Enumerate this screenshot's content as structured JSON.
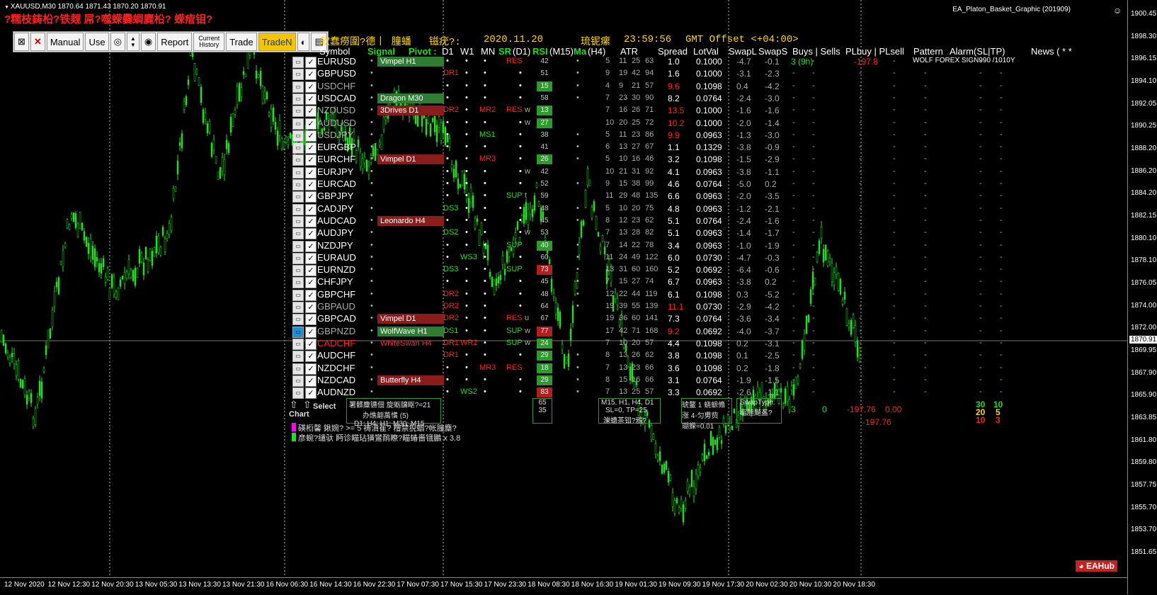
{
  "chart": {
    "symbol_header": "XAUUSD,M30  1870.64 1871.43 1870.20 1870.91",
    "title_red": "?糯枝鋳柗?铁觌  屌?噬蝾爨蜩麑柗? 蝾痯钼?",
    "ea_label": "EA_Platon_Basket_Graphic (201909)",
    "current_price": "1870.91",
    "price_ticks": [
      "1900.45",
      "1898.30",
      "1896.15",
      "1894.10",
      "1892.05",
      "1890.25",
      "1888.20",
      "1886.20",
      "1884.20",
      "1882.15",
      "1880.10",
      "1878.10",
      "1876.05",
      "1874.00",
      "1872.00",
      "1869.95",
      "1867.90",
      "1865.90",
      "1863.85",
      "1861.80",
      "1859.80",
      "1857.75",
      "1855.70",
      "1853.70",
      "1851.65"
    ],
    "time_ticks": [
      "12 Nov 2020",
      "12 Nov 12:30",
      "12 Nov 20:30",
      "13 Nov 05:30",
      "13 Nov 13:30",
      "13 Nov 21:30",
      "16 Nov 06:30",
      "16 Nov 14:30",
      "16 Nov 22:30",
      "17 Nov 07:30",
      "17 Nov 15:30",
      "17 Nov 23:30",
      "18 Nov 08:30",
      "18 Nov 16:30",
      "19 Nov 01:30",
      "19 Nov 09:30",
      "19 Nov 17:30",
      "20 Nov 02:30",
      "20 Nov 10:30",
      "20 Nov 18:30"
    ],
    "watermark": "EAHub",
    "colors": {
      "bull": "#22dd22",
      "bear": "#22dd22",
      "bg": "#000000"
    }
  },
  "toolbar": {
    "buttons": [
      "Manual",
      "Use",
      "Report",
      "Current History",
      "Trade",
      "TradeN"
    ],
    "active": "TradeN"
  },
  "dashboard": {
    "left_label": "软蠢痨圍?德丨 膧蟠",
    "date_label": "镃疣?:",
    "date_value": "2020.11.20",
    "time_label": "琉铌瘰",
    "time_value": "23:59:56",
    "gmt": "GMT Offset <+04:00>",
    "headers": [
      "Symbol",
      "Signal",
      "Pivot :",
      "D1",
      "W1",
      "MN",
      "SR",
      "(D1)",
      "RSI",
      "(M15)",
      "Ma",
      "(H4)",
      "ATR",
      "Spread",
      "LotVal",
      "SwapL",
      "SwapS",
      "Buys | Sells",
      "PLbuy | PLsell",
      "Pattern",
      "Alarm(SL|TP)",
      "News ( * *"
    ],
    "rows": [
      {
        "sym": "EURUSD",
        "sc": "wht",
        "sig": "Vimpel H1",
        "sigc": "green",
        "d1": "•",
        "w1": "•",
        "mn": "•",
        "sr": "RES",
        "rsi": "42",
        "rsic": "",
        "ma": "•",
        "atr": [
          "5",
          "11",
          "25",
          "63"
        ],
        "spread": "1.0",
        "sprc": "wht",
        "lot": "0.1000",
        "sl": "-4.7",
        "ss": "-0.1",
        "buys": "3 (9h)",
        "plb": "-197.8",
        "pattern": "WOLF FOREX SIGN990 /1010Y"
      },
      {
        "sym": "GBPUSD",
        "sc": "wht",
        "sig": "",
        "sigc": "",
        "d1": "DR1",
        "w1": "•",
        "mn": "•",
        "sr": "•",
        "rsi": "51",
        "rsic": "",
        "ma": "•",
        "atr": [
          "9",
          "19",
          "42",
          "94"
        ],
        "spread": "1.6",
        "sprc": "wht",
        "lot": "0.1000",
        "sl": "-3.1",
        "ss": "-2.3",
        "buys": "",
        "plb": "",
        "pattern": ""
      },
      {
        "sym": "USDCHF",
        "sc": "gry",
        "sig": "",
        "sigc": "",
        "d1": "•",
        "w1": "•",
        "mn": "•",
        "sr": "•",
        "rsi": "15",
        "rsic": "g",
        "ma": "•",
        "atr": [
          "4",
          "9",
          "21",
          "57"
        ],
        "spread": "9.6",
        "sprc": "red",
        "lot": "0.1098",
        "sl": "0.4",
        "ss": "-4.2",
        "buys": "",
        "plb": "",
        "pattern": ""
      },
      {
        "sym": "USDCAD",
        "sc": "wht",
        "sig": "Dragon M30",
        "sigc": "green",
        "d1": "•",
        "w1": "•",
        "mn": "•",
        "sr": "•",
        "rsi": "58",
        "rsic": "",
        "ma": "•",
        "atr": [
          "7",
          "23",
          "30",
          "90"
        ],
        "spread": "8.2",
        "sprc": "wht",
        "lot": "0.0764",
        "sl": "-2.4",
        "ss": "-3.0",
        "buys": "",
        "plb": "",
        "pattern": ""
      },
      {
        "sym": "NZDUSD",
        "sc": "gry",
        "sig": "3Drives D1",
        "sigc": "red",
        "d1": "DR2",
        "w1": "•",
        "mn": "MR2",
        "sr": "RES",
        "rsi": "13",
        "rsic": "g",
        "ma": "w",
        "atr": [
          "7",
          "16",
          "26",
          "71"
        ],
        "spread": "13.5",
        "sprc": "red",
        "lot": "0.1000",
        "sl": "-1.6",
        "ss": "-1.6",
        "buys": "",
        "plb": "",
        "pattern": ""
      },
      {
        "sym": "AUDUSD",
        "sc": "gry",
        "sig": "",
        "sigc": "",
        "d1": "•",
        "w1": "•",
        "mn": "•",
        "sr": "•",
        "rsi": "27",
        "rsic": "g",
        "ma": "w",
        "atr": [
          "10",
          "20",
          "25",
          "72"
        ],
        "spread": "10.2",
        "sprc": "red",
        "lot": "0.1000",
        "sl": "-2.0",
        "ss": "-1.4",
        "buys": "",
        "plb": "",
        "pattern": ""
      },
      {
        "sym": "USDJPY",
        "sc": "gry",
        "sig": "",
        "sigc": "",
        "d1": "•",
        "w1": "•",
        "mn": "MS1",
        "sr": "•",
        "rsi": "38",
        "rsic": "",
        "ma": "•",
        "atr": [
          "5",
          "11",
          "23",
          "86"
        ],
        "spread": "9.9",
        "sprc": "red",
        "lot": "0.0963",
        "sl": "-1.3",
        "ss": "-3.0",
        "buys": "",
        "plb": "",
        "pattern": ""
      },
      {
        "sym": "EURGBP",
        "sc": "wht",
        "sig": "",
        "sigc": "",
        "d1": "•",
        "w1": "•",
        "mn": "•",
        "sr": "•",
        "rsi": "41",
        "rsic": "",
        "ma": "•",
        "atr": [
          "6",
          "13",
          "27",
          "67"
        ],
        "spread": "1.1",
        "sprc": "wht",
        "lot": "0.1329",
        "sl": "-3.8",
        "ss": "-0.9",
        "buys": "",
        "plb": "",
        "pattern": ""
      },
      {
        "sym": "EURCHF",
        "sc": "wht",
        "sig": "Vimpel D1",
        "sigc": "red",
        "d1": "•",
        "w1": "•",
        "mn": "MR3",
        "sr": "•",
        "rsi": "26",
        "rsic": "g",
        "ma": "•",
        "atr": [
          "5",
          "10",
          "16",
          "46"
        ],
        "spread": "3.2",
        "sprc": "wht",
        "lot": "0.1098",
        "sl": "-1.5",
        "ss": "-2.9",
        "buys": "",
        "plb": "",
        "pattern": ""
      },
      {
        "sym": "EURJPY",
        "sc": "wht",
        "sig": "",
        "sigc": "",
        "d1": "•",
        "w1": "•",
        "mn": "•",
        "sr": "•",
        "rsi": "42",
        "rsic": "",
        "ma": "w",
        "atr": [
          "10",
          "21",
          "31",
          "92"
        ],
        "spread": "4.1",
        "sprc": "wht",
        "lot": "0.0963",
        "sl": "-3.8",
        "ss": "-1.1",
        "buys": "",
        "plb": "",
        "pattern": ""
      },
      {
        "sym": "EURCAD",
        "sc": "wht",
        "sig": "",
        "sigc": "",
        "d1": "•",
        "w1": "•",
        "mn": "•",
        "sr": "•",
        "rsi": "52",
        "rsic": "",
        "ma": "•",
        "atr": [
          "9",
          "15",
          "38",
          "99"
        ],
        "spread": "4.6",
        "sprc": "wht",
        "lot": "0.0764",
        "sl": "-5.0",
        "ss": "0.2",
        "buys": "",
        "plb": "",
        "pattern": ""
      },
      {
        "sym": "GBPJPY",
        "sc": "wht",
        "sig": "",
        "sigc": "",
        "d1": "•",
        "w1": "•",
        "mn": "•",
        "sr": "SUP",
        "rsi": "59",
        "rsic": "",
        "ma": "t",
        "atr": [
          "11",
          "29",
          "48",
          "135"
        ],
        "spread": "6.6",
        "sprc": "wht",
        "lot": "0.0963",
        "sl": "-2.0",
        "ss": "-3.5",
        "buys": "",
        "plb": "",
        "pattern": ""
      },
      {
        "sym": "CADJPY",
        "sc": "wht",
        "sig": "",
        "sigc": "",
        "d1": "DS3",
        "w1": "•",
        "mn": "•",
        "sr": "•",
        "rsi": "48",
        "rsic": "",
        "ma": "•",
        "atr": [
          "5",
          "10",
          "20",
          "75"
        ],
        "spread": "4.8",
        "sprc": "wht",
        "lot": "0.0963",
        "sl": "-1.2",
        "ss": "-2.1",
        "buys": "",
        "plb": "",
        "pattern": ""
      },
      {
        "sym": "AUDCAD",
        "sc": "wht",
        "sig": "Leonardo H4",
        "sigc": "red",
        "d1": "•",
        "w1": "•",
        "mn": "•",
        "sr": "•",
        "rsi": "45",
        "rsic": "",
        "ma": "•",
        "atr": [
          "8",
          "12",
          "23",
          "62"
        ],
        "spread": "5.1",
        "sprc": "wht",
        "lot": "0.0764",
        "sl": "-2.4",
        "ss": "-1.6",
        "buys": "",
        "plb": "",
        "pattern": ""
      },
      {
        "sym": "AUDJPY",
        "sc": "wht",
        "sig": "",
        "sigc": "",
        "d1": "DS2",
        "w1": "•",
        "mn": "•",
        "sr": "•",
        "rsi": "53",
        "rsic": "",
        "ma": "w",
        "atr": [
          "7",
          "13",
          "28",
          "82"
        ],
        "spread": "5.1",
        "sprc": "wht",
        "lot": "0.0963",
        "sl": "-1.4",
        "ss": "-1.7",
        "buys": "",
        "plb": "",
        "pattern": ""
      },
      {
        "sym": "NZDJPY",
        "sc": "wht",
        "sig": "",
        "sigc": "",
        "d1": "•",
        "w1": "•",
        "mn": "•",
        "sr": "SUP",
        "rsi": "40",
        "rsic": "g",
        "ma": "•",
        "atr": [
          "7",
          "14",
          "22",
          "78"
        ],
        "spread": "3.4",
        "sprc": "wht",
        "lot": "0.0963",
        "sl": "-1.0",
        "ss": "-1.9",
        "buys": "",
        "plb": "",
        "pattern": ""
      },
      {
        "sym": "EURAUD",
        "sc": "wht",
        "sig": "",
        "sigc": "",
        "d1": "•",
        "w1": "WS3",
        "mn": "•",
        "sr": "•",
        "rsi": "60",
        "rsic": "",
        "ma": "•",
        "atr": [
          "11",
          "24",
          "49",
          "122"
        ],
        "spread": "6.0",
        "sprc": "wht",
        "lot": "0.0730",
        "sl": "-4.7",
        "ss": "-0.3",
        "buys": "",
        "plb": "",
        "pattern": ""
      },
      {
        "sym": "EURNZD",
        "sc": "wht",
        "sig": "",
        "sigc": "",
        "d1": "DS3",
        "w1": "•",
        "mn": "•",
        "sr": "SUP",
        "rsi": "73",
        "rsic": "r",
        "ma": "•",
        "atr": [
          "13",
          "31",
          "60",
          "160"
        ],
        "spread": "5.2",
        "sprc": "wht",
        "lot": "0.0692",
        "sl": "-6.4",
        "ss": "-0.6",
        "buys": "",
        "plb": "",
        "pattern": ""
      },
      {
        "sym": "CHFJPY",
        "sc": "wht",
        "sig": "",
        "sigc": "",
        "d1": "•",
        "w1": "•",
        "mn": "•",
        "sr": "•",
        "rsi": "45",
        "rsic": "",
        "ma": "•",
        "atr": [
          "7",
          "15",
          "27",
          "74"
        ],
        "spread": "6.7",
        "sprc": "wht",
        "lot": "0.0963",
        "sl": "-3.8",
        "ss": "0.2",
        "buys": "",
        "plb": "",
        "pattern": ""
      },
      {
        "sym": "GBPCHF",
        "sc": "wht",
        "sig": "",
        "sigc": "",
        "d1": "DR2",
        "w1": "•",
        "mn": "•",
        "sr": "•",
        "rsi": "48",
        "rsic": "",
        "ma": "•",
        "atr": [
          "12",
          "22",
          "44",
          "119"
        ],
        "spread": "6.1",
        "sprc": "wht",
        "lot": "0.1098",
        "sl": "0.3",
        "ss": "-5.2",
        "buys": "",
        "plb": "",
        "pattern": ""
      },
      {
        "sym": "GBPAUD",
        "sc": "gry",
        "sig": "",
        "sigc": "",
        "d1": "DR2",
        "w1": "•",
        "mn": "•",
        "sr": "•",
        "rsi": "64",
        "rsic": "",
        "ma": "•",
        "atr": [
          "19",
          "39",
          "55",
          "139"
        ],
        "spread": "11.1",
        "sprc": "red",
        "lot": "0.0730",
        "sl": "-2.9",
        "ss": "-4.2",
        "buys": "",
        "plb": "",
        "pattern": ""
      },
      {
        "sym": "GBPCAD",
        "sc": "wht",
        "sig": "Vimpel D1",
        "sigc": "red",
        "d1": "DR2",
        "w1": "•",
        "mn": "•",
        "sr": "RES",
        "rsi": "67",
        "rsic": "",
        "ma": "u",
        "atr": [
          "19",
          "36",
          "60",
          "141"
        ],
        "spread": "7.3",
        "sprc": "wht",
        "lot": "0.0764",
        "sl": "-3.6",
        "ss": "-3.4",
        "buys": "",
        "plb": "",
        "pattern": ""
      },
      {
        "sym": "GBPNZD",
        "sc": "gry",
        "sig": "WolfWave H1",
        "sigc": "green",
        "d1": "DS1",
        "w1": "•",
        "mn": "•",
        "sr": "SUP",
        "rsi": "77",
        "rsic": "r",
        "ma": "w",
        "atr": [
          "17",
          "42",
          "71",
          "168"
        ],
        "spread": "9.2",
        "sprc": "red",
        "lot": "0.0692",
        "sl": "-4.0",
        "ss": "-3.7",
        "buys": "",
        "plb": "",
        "pattern": ""
      },
      {
        "sym": "CADCHF",
        "sc": "red",
        "sig": "WhiteSwan H4",
        "sigc": "txtred",
        "d1": "DR1",
        "w1": "WR2",
        "mn": "•",
        "sr": "SUP",
        "rsi": "24",
        "rsic": "g",
        "ma": "w",
        "atr": [
          "7",
          "10",
          "20",
          "57"
        ],
        "spread": "4.4",
        "sprc": "wht",
        "lot": "0.1098",
        "sl": "0.2",
        "ss": "-3.1",
        "buys": "",
        "plb": "",
        "pattern": ""
      },
      {
        "sym": "AUDCHF",
        "sc": "wht",
        "sig": "",
        "sigc": "",
        "d1": "DR1",
        "w1": "•",
        "mn": "•",
        "sr": "•",
        "rsi": "29",
        "rsic": "g",
        "ma": "•",
        "atr": [
          "8",
          "13",
          "26",
          "62"
        ],
        "spread": "3.8",
        "sprc": "wht",
        "lot": "0.1098",
        "sl": "0.1",
        "ss": "-2.5",
        "buys": "",
        "plb": "",
        "pattern": ""
      },
      {
        "sym": "NZDCHF",
        "sc": "wht",
        "sig": "",
        "sigc": "",
        "d1": "•",
        "w1": "•",
        "mn": "MR3",
        "sr": "RES",
        "rsi": "18",
        "rsic": "g",
        "ma": "•",
        "atr": [
          "7",
          "13",
          "23",
          "66"
        ],
        "spread": "3.6",
        "sprc": "wht",
        "lot": "0.1098",
        "sl": "0.2",
        "ss": "-1.8",
        "buys": "",
        "plb": "",
        "pattern": ""
      },
      {
        "sym": "NZDCAD",
        "sc": "wht",
        "sig": "Butterfly H4",
        "sigc": "red",
        "d1": "•",
        "w1": "•",
        "mn": "•",
        "sr": "•",
        "rsi": "29",
        "rsic": "g",
        "ma": "•",
        "atr": [
          "8",
          "15",
          "16",
          "66"
        ],
        "spread": "3.1",
        "sprc": "wht",
        "lot": "0.0764",
        "sl": "-1.9",
        "ss": "-1.5",
        "buys": "",
        "plb": "",
        "pattern": ""
      },
      {
        "sym": "AUDNZD",
        "sc": "wht",
        "sig": "",
        "sigc": "",
        "d1": "•",
        "w1": "WS2",
        "mn": "•",
        "sr": "•",
        "rsi": "83",
        "rsic": "r",
        "ma": "•",
        "atr": [
          "7",
          "13",
          "25",
          "57"
        ],
        "spread": "3.3",
        "sprc": "wht",
        "lot": "0.0692",
        "sl": "-2.6",
        "ss": "-1.1",
        "buys": "",
        "plb": "",
        "pattern": ""
      }
    ],
    "bottom": {
      "chart_label": "Chart",
      "select_label": "Select",
      "tf_box_line1": "署髒麋镳佃 旋蛎牖眍?=21",
      "tf_box_line2": "办燋翿萬愭 (5)",
      "tf_box_line3": "D1; H4; H1; M30; M15",
      "rsi_box": [
        "65",
        "35"
      ],
      "ma_box_line1": "M15, H1, H4, D1",
      "ma_box_line2": "SL=0, TP=25",
      "ma_box_line3": "濼蟪茶钼?鴉?",
      "spread_box_line1": "琥鳌 1 蛲蟅翛",
      "spread_box_line2": "涨 4-匀旉赀",
      "spread_box_line3": "瑚蝾=0.01",
      "swap_box_line1": "SwapType:",
      "swap_box_line2": "鼋胆飈盋?",
      "buys_total": "3",
      "sells_total": "0",
      "pl_buy_total": "-197.76",
      "pl_sell_total": "0.00",
      "pl_sum": "-197.76",
      "alarm_grid": [
        [
          "30",
          "10"
        ],
        [
          "20",
          "5"
        ],
        [
          "10",
          "3"
        ]
      ],
      "legend1": "碤椼馨    鍬婉? >= 5 祷濆萑? 橹禁猊蝈?帐膧麋?",
      "legend2": "彦蜿?缱驮    眄诊瞄玷獚鸞鸸瞭?瞄蝽嗇锇鵬 x 3.8"
    }
  }
}
